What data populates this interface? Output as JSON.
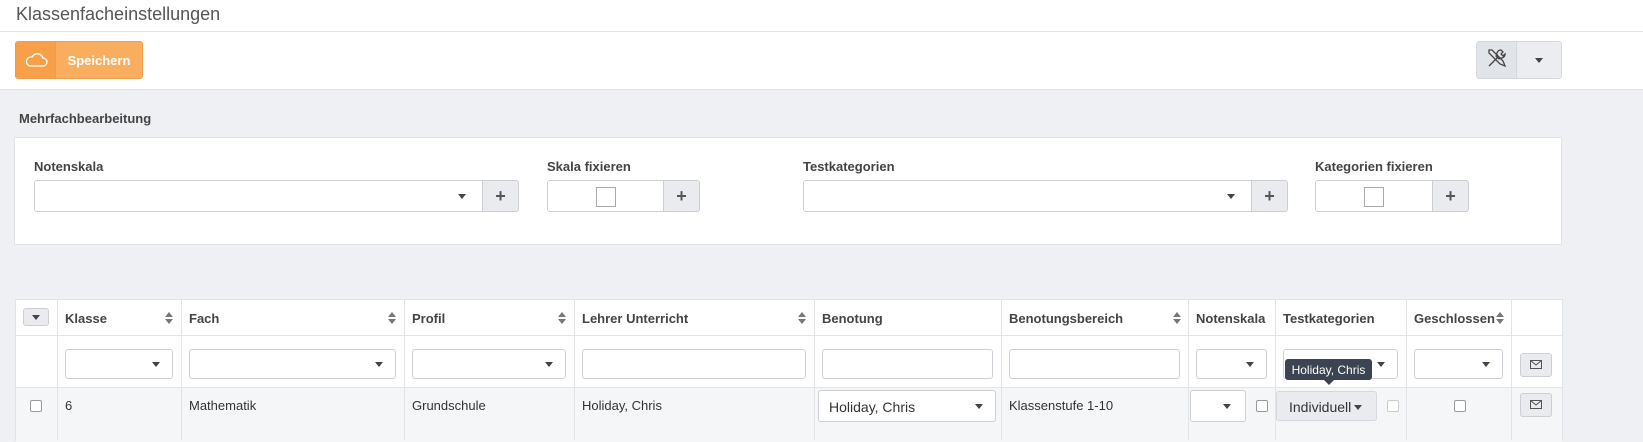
{
  "page": {
    "title": "Klassenfacheinstellungen"
  },
  "toolbar": {
    "save_label": "Speichern",
    "save_icon": "cloud-icon",
    "tools_icon": "wrench-screwdriver-icon"
  },
  "bulk": {
    "title": "Mehrfachbearbeitung",
    "notenskala_label": "Notenskala",
    "skala_fix_label": "Skala fixieren",
    "testkategorien_label": "Testkategorien",
    "kategorien_fix_label": "Kategorien fixieren",
    "plus": "+"
  },
  "grid": {
    "columns": [
      "Klasse",
      "Fach",
      "Profil",
      "Lehrer Unterricht",
      "Benotung",
      "Benotungsbereich",
      "Notenskala",
      "Testkategorien",
      "Geschlossen"
    ],
    "rows": [
      {
        "klasse": "6",
        "fach": "Mathematik",
        "profil": "Grundschule",
        "lehrer": "Holiday, Chris",
        "benotung": "Holiday, Chris",
        "benotungsbereich": "Klassenstufe 1-10",
        "testkategorien": "Individuell"
      }
    ],
    "tooltip": "Holiday, Chris"
  },
  "colors": {
    "accent": "#f9ad5e",
    "tooltip_bg": "#3b4450"
  }
}
